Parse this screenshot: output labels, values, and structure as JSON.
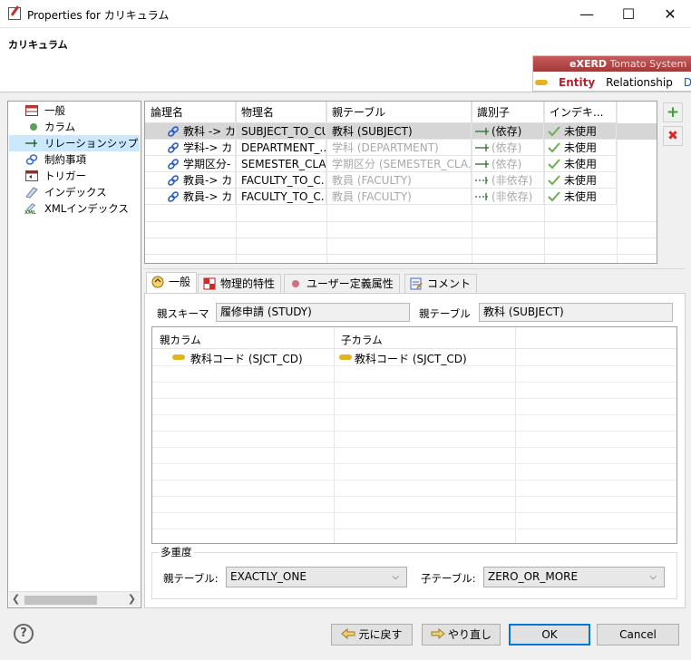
{
  "window": {
    "title": "Properties for カリキュラム",
    "controls": [
      "minimize",
      "maximize",
      "close"
    ]
  },
  "header": {
    "heading": "カリキュラム",
    "banner": {
      "product": "eXERD",
      "edition": "Tomato System",
      "tabs": [
        "Entity",
        "Relationship",
        "Diag"
      ]
    }
  },
  "tree": {
    "items": [
      {
        "label": "一般",
        "icon": "table-icon"
      },
      {
        "label": "カラム",
        "icon": "column-dot-icon"
      },
      {
        "label": "リレーションシップ",
        "icon": "relationship-arrow-icon",
        "selected": true
      },
      {
        "label": "制約事項",
        "icon": "constraint-icon"
      },
      {
        "label": "トリガー",
        "icon": "trigger-icon"
      },
      {
        "label": "インデックス",
        "icon": "index-icon"
      },
      {
        "label": "XMLインデックス",
        "icon": "xml-index-icon"
      }
    ]
  },
  "relations": {
    "columns": [
      "論理名",
      "物理名",
      "親テーブル",
      "識別子",
      "インデキ..."
    ],
    "rows": [
      {
        "logical": "教科 -> カ",
        "physical": "SUBJECT_TO_CUR",
        "parent": "教科 (SUBJECT)",
        "identifier": "(依存)",
        "index": "未使用",
        "parent_gray": false,
        "ident_gray": false
      },
      {
        "logical": "学科-> カ",
        "physical": "DEPARTMENT_...",
        "parent": "学科 (DEPARTMENT)",
        "identifier": "(依存)",
        "index": "未使用",
        "parent_gray": true,
        "ident_gray": true
      },
      {
        "logical": "学期区分-",
        "physical": "SEMESTER_CLA...",
        "parent": "学期区分 (SEMESTER_CLA...",
        "identifier": "(依存)",
        "index": "未使用",
        "parent_gray": true,
        "ident_gray": true
      },
      {
        "logical": "教員-> カ",
        "physical": "FACULTY_TO_C...",
        "parent": "教員 (FACULTY)",
        "identifier": "(非依存)",
        "index": "未使用",
        "parent_gray": true,
        "ident_gray": true
      },
      {
        "logical": "教員-> カ",
        "physical": "FACULTY_TO_C...",
        "parent": "教員 (FACULTY)",
        "identifier": "(非依存)",
        "index": "未使用",
        "parent_gray": true,
        "ident_gray": true
      }
    ],
    "add": "+",
    "remove": "✖"
  },
  "detail": {
    "tabs": [
      "一般",
      "物理的特性",
      "ユーザー定義属性",
      "コメント"
    ],
    "parent_schema_label": "親スキーマ",
    "parent_schema_value": "履修申請 (STUDY)",
    "parent_table_label": "親テーブル",
    "parent_table_value": "教科 (SUBJECT)",
    "column_headers": [
      "親カラム",
      "子カラム"
    ],
    "column_rows": [
      {
        "parent": "教科コード (SJCT_CD)",
        "child": "教科コード (SJCT_CD)"
      }
    ],
    "multiplicity": {
      "legend": "多重度",
      "parent_label": "親テーブル:",
      "parent_value": "EXACTLY_ONE",
      "child_label": "子テーブル:",
      "child_value": "ZERO_OR_MORE"
    }
  },
  "footer": {
    "help": "?",
    "restore_defaults": "元に戻す",
    "apply": "やり直し",
    "ok": "OK",
    "cancel": "Cancel"
  },
  "colors": {
    "selection_tree": "#cce8ff",
    "selection_row": "#d6d6d6",
    "banner_red": "#a23a3a",
    "primary_border": "#0078d7",
    "entity_red": "#b8202a"
  }
}
